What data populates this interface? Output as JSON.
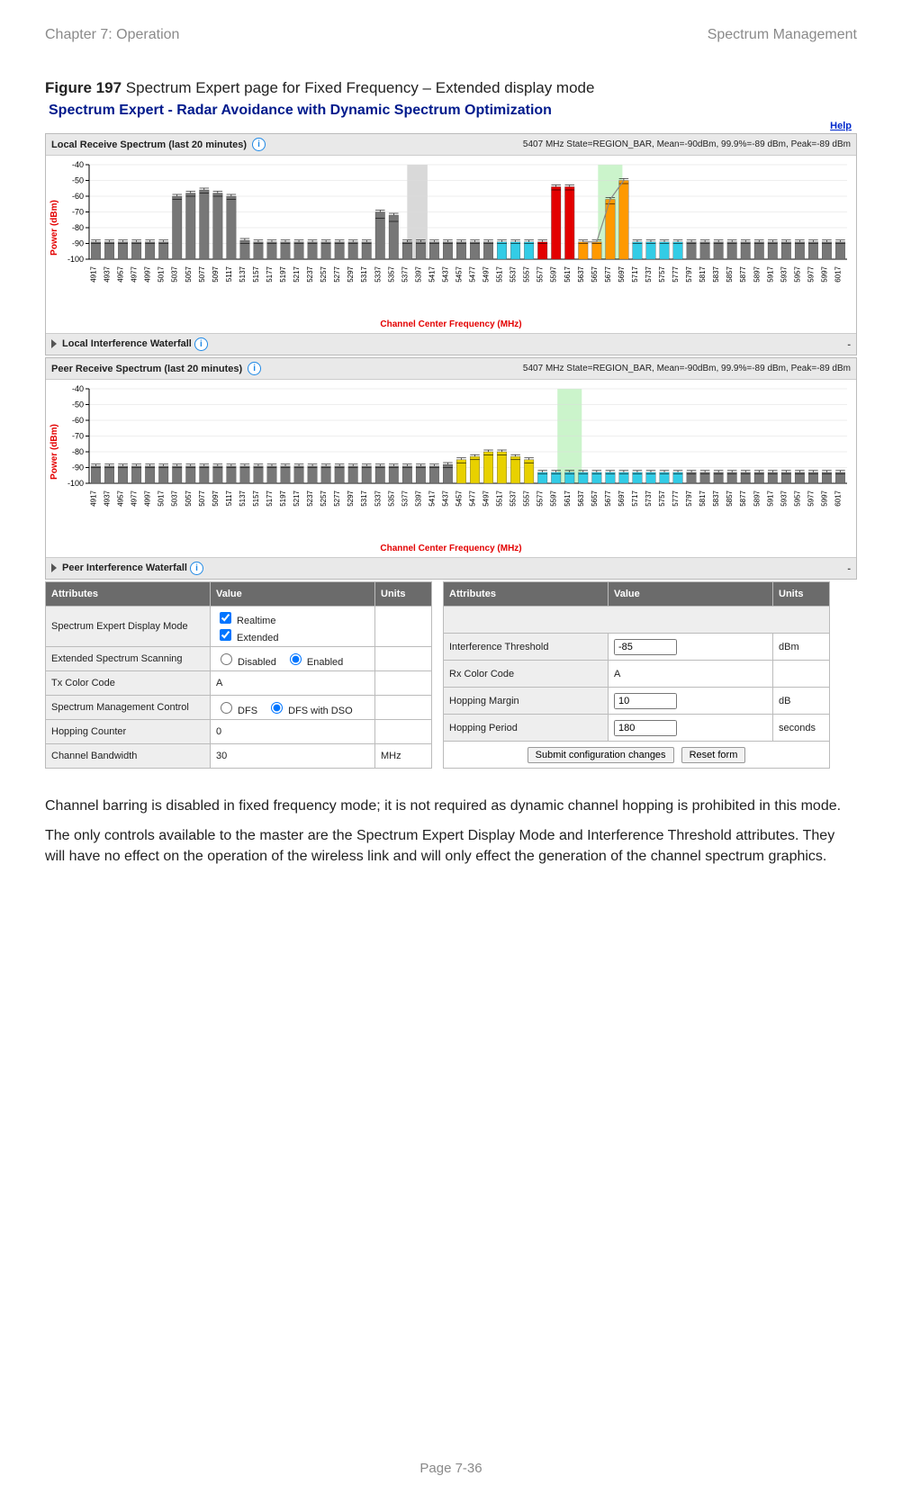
{
  "doc_header": {
    "chapter": "Chapter 7:  Operation",
    "section": "Spectrum Management"
  },
  "figure_caption": {
    "label": "Figure 197",
    "text": "Spectrum Expert page for Fixed Frequency – Extended display mode"
  },
  "panel_title": "Spectrum Expert - Radar Avoidance with Dynamic Spectrum Optimization",
  "help_link": "Help",
  "chart_labels": {
    "y_axis": "Power (dBm)",
    "x_axis": "Channel Center Frequency (MHz)"
  },
  "local_panel": {
    "title": "Local Receive Spectrum (last 20 minutes)",
    "status": "5407 MHz State=REGION_BAR, Mean=-90dBm, 99.9%=-89 dBm, Peak=-89 dBm",
    "waterfall": "Local Interference Waterfall"
  },
  "peer_panel": {
    "title": "Peer Receive Spectrum (last 20 minutes)",
    "status": "5407 MHz State=REGION_BAR, Mean=-90dBm, 99.9%=-89 dBm, Peak=-89 dBm",
    "waterfall": "Peer Interference Waterfall"
  },
  "attributes_left": {
    "headers": [
      "Attributes",
      "Value",
      "Units"
    ],
    "rows": [
      {
        "label": "Spectrum Expert Display Mode",
        "value_checkboxes": [
          "Realtime",
          "Extended"
        ]
      },
      {
        "label": "Extended Spectrum Scanning",
        "value_radios": [
          {
            "t": "Disabled",
            "c": false
          },
          {
            "t": "Enabled",
            "c": true
          }
        ]
      },
      {
        "label": "Tx Color Code",
        "value_text": "A"
      },
      {
        "label": "Spectrum Management Control",
        "value_radios": [
          {
            "t": "DFS",
            "c": false
          },
          {
            "t": "DFS with DSO",
            "c": true
          }
        ]
      },
      {
        "label": "Hopping Counter",
        "value_text": "0"
      },
      {
        "label": "Channel Bandwidth",
        "value_text": "30",
        "units": "MHz"
      }
    ]
  },
  "attributes_right": {
    "headers": [
      "Attributes",
      "Value",
      "Units"
    ],
    "rows": [
      {
        "empty": true
      },
      {
        "label": "Interference Threshold",
        "value_input": "-85",
        "units": "dBm"
      },
      {
        "label": "Rx Color Code",
        "value_text": "A"
      },
      {
        "label": "Hopping Margin",
        "value_input": "10",
        "units": "dB"
      },
      {
        "label": "Hopping Period",
        "value_input": "180",
        "units": "seconds"
      },
      {
        "buttons": [
          "Submit configuration changes",
          "Reset form"
        ]
      }
    ]
  },
  "body_paragraphs": [
    "Channel barring is disabled in fixed frequency mode; it is not required as dynamic channel hopping is prohibited in this mode.",
    "The only controls available to the master are the Spectrum Expert Display Mode and Interference Threshold attributes. They will have no effect on the operation of the wireless link and will only effect the generation of the channel spectrum graphics."
  ],
  "page_footer": "Page 7-36",
  "chart_data": [
    {
      "type": "bar",
      "name": "local",
      "ylabel": "Power (dBm)",
      "xlabel": "Channel Center Frequency (MHz)",
      "ylim": [
        -100,
        -40
      ],
      "y_ticks": [
        -100,
        -90,
        -80,
        -70,
        -60,
        -50,
        -40
      ],
      "categories": [
        4917,
        4937,
        4957,
        4977,
        4997,
        5017,
        5037,
        5057,
        5077,
        5097,
        5117,
        5137,
        5157,
        5177,
        5197,
        5217,
        5237,
        5257,
        5277,
        5297,
        5317,
        5337,
        5357,
        5377,
        5397,
        5417,
        5437,
        5457,
        5477,
        5497,
        5517,
        5537,
        5557,
        5577,
        5597,
        5617,
        5637,
        5657,
        5677,
        5697,
        5717,
        5737,
        5757,
        5777,
        5797,
        5817,
        5837,
        5857,
        5877,
        5897,
        5917,
        5937,
        5957,
        5977,
        5997,
        6017
      ],
      "series": [
        {
          "name": "peak",
          "color": "#777",
          "values": [
            -89,
            -89,
            -89,
            -89,
            -89,
            -89,
            -60,
            -58,
            -56,
            -58,
            -60,
            -88,
            -89,
            -89,
            -89,
            -89,
            -89,
            -89,
            -89,
            -89,
            -89,
            -70,
            -72,
            -89,
            -89,
            -89,
            -89,
            -89,
            -89,
            -89,
            -89,
            -89,
            -89,
            -89,
            -54,
            -54,
            -89,
            -89,
            -62,
            -50,
            -89,
            -89,
            -89,
            -89,
            -89,
            -89,
            -89,
            -89,
            -89,
            -89,
            -89,
            -89,
            -89,
            -89,
            -89,
            -89
          ]
        },
        {
          "name": "mean",
          "color": "#444",
          "values": [
            -90,
            -90,
            -90,
            -90,
            -90,
            -90,
            -62,
            -60,
            -58,
            -60,
            -62,
            -90,
            -90,
            -90,
            -90,
            -90,
            -90,
            -90,
            -90,
            -90,
            -90,
            -74,
            -76,
            -90,
            -90,
            -90,
            -90,
            -90,
            -90,
            -90,
            -90,
            -90,
            -90,
            -90,
            -56,
            -56,
            -90,
            -90,
            -65,
            -52,
            -90,
            -90,
            -90,
            -90,
            -90,
            -90,
            -90,
            -90,
            -90,
            -90,
            -90,
            -90,
            -90,
            -90,
            -90,
            -90
          ]
        }
      ],
      "markers": {
        "red_indices": [
          33,
          34,
          35
        ],
        "orange_indices": [
          36,
          37,
          38,
          39
        ],
        "cyan_indices": [
          30,
          31,
          32,
          40,
          41,
          42,
          43
        ],
        "green_band_index": 38
      }
    },
    {
      "type": "bar",
      "name": "peer",
      "ylabel": "Power (dBm)",
      "xlabel": "Channel Center Frequency (MHz)",
      "ylim": [
        -100,
        -40
      ],
      "y_ticks": [
        -100,
        -90,
        -80,
        -70,
        -60,
        -50,
        -40
      ],
      "categories": [
        4917,
        4937,
        4957,
        4977,
        4997,
        5017,
        5037,
        5057,
        5077,
        5097,
        5117,
        5137,
        5157,
        5177,
        5197,
        5217,
        5237,
        5257,
        5277,
        5297,
        5317,
        5337,
        5357,
        5377,
        5397,
        5417,
        5437,
        5457,
        5477,
        5497,
        5517,
        5537,
        5557,
        5577,
        5597,
        5617,
        5637,
        5657,
        5677,
        5697,
        5717,
        5737,
        5757,
        5777,
        5797,
        5817,
        5837,
        5857,
        5877,
        5897,
        5917,
        5937,
        5957,
        5977,
        5997,
        6017
      ],
      "series": [
        {
          "name": "peak",
          "color": "#777",
          "values": [
            -89,
            -89,
            -89,
            -89,
            -89,
            -89,
            -89,
            -89,
            -89,
            -89,
            -89,
            -89,
            -89,
            -89,
            -89,
            -89,
            -89,
            -89,
            -89,
            -89,
            -89,
            -89,
            -89,
            -89,
            -89,
            -89,
            -88,
            -85,
            -83,
            -80,
            -80,
            -83,
            -85,
            -93,
            -93,
            -93,
            -93,
            -93,
            -93,
            -93,
            -93,
            -93,
            -93,
            -93,
            -93,
            -93,
            -93,
            -93,
            -93,
            -93,
            -93,
            -93,
            -93,
            -93,
            -93,
            -93
          ]
        },
        {
          "name": "mean",
          "color": "#444",
          "values": [
            -90,
            -90,
            -90,
            -90,
            -90,
            -90,
            -90,
            -90,
            -90,
            -90,
            -90,
            -90,
            -90,
            -90,
            -90,
            -90,
            -90,
            -90,
            -90,
            -90,
            -90,
            -90,
            -90,
            -90,
            -90,
            -90,
            -90,
            -87,
            -85,
            -82,
            -82,
            -85,
            -87,
            -94,
            -94,
            -94,
            -94,
            -94,
            -94,
            -94,
            -94,
            -94,
            -94,
            -94,
            -94,
            -94,
            -94,
            -94,
            -94,
            -94,
            -94,
            -94,
            -94,
            -94,
            -94,
            -94
          ]
        }
      ],
      "markers": {
        "yellow_indices": [
          27,
          28,
          29,
          30,
          31,
          32
        ],
        "cyan_indices": [
          33,
          34,
          35,
          36,
          37,
          38,
          39,
          40,
          41,
          42,
          43
        ],
        "green_band_index": 35
      }
    }
  ]
}
